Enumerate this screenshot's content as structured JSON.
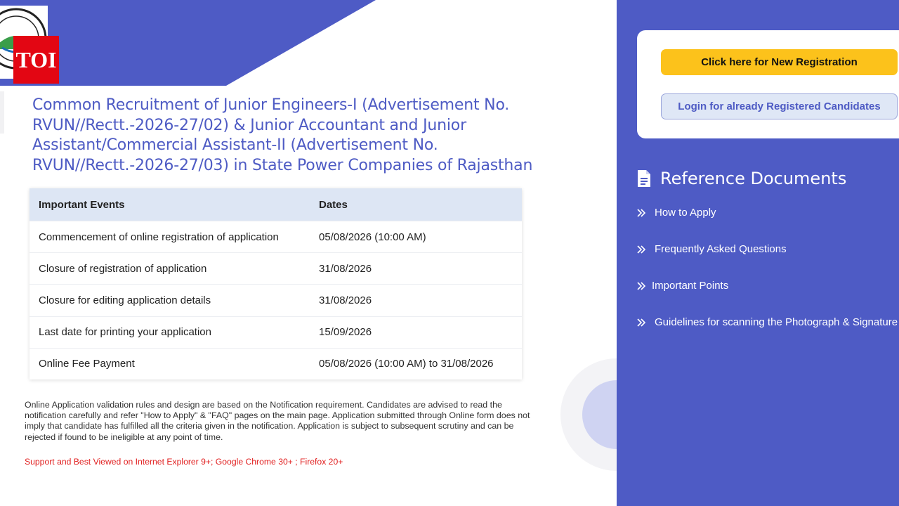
{
  "brand": {
    "badge_text": "TOI"
  },
  "title": "Common Recruitment of Junior Engineers-I (Advertisement No. RVUN//Rectt.-2026-27/02) & Junior Accountant and Junior Assistant/Commercial Assistant-II (Advertisement No. RVUN//Rectt.-2026-27/03) in State Power Companies of Rajasthan",
  "events_table": {
    "headers": [
      "Important Events",
      "Dates"
    ],
    "rows": [
      [
        "Commencement of online registration of application",
        "05/08/2026 (10:00 AM)"
      ],
      [
        "Closure of registration of application",
        "31/08/2026"
      ],
      [
        "Closure for editing application details",
        "31/08/2026"
      ],
      [
        "Last date for printing your application",
        "15/09/2026"
      ],
      [
        "Online Fee Payment",
        "05/08/2026 (10:00 AM) to 31/08/2026"
      ]
    ]
  },
  "note": "Online Application validation rules and design are based on the Notification requirement. Candidates are advised to read the notification carefully and refer \"How to Apply\" & \"FAQ\" pages on the main page. Application submitted through Online form does not imply that candidate has fulfilled all the criteria given in the notification. Application is subject to subsequent scrutiny and can be rejected if found to be ineligible at any point of time.",
  "support_text": "Support and Best Viewed on Internet Explorer 9+; Google Chrome 30+ ; Firefox 20+",
  "registration": {
    "new_label": "Click here for New Registration",
    "login_label": "Login for already Registered Candidates"
  },
  "reference": {
    "heading": "Reference Documents",
    "icon": "document-icon",
    "items": [
      {
        "label": "How to Apply",
        "icon": "double-chevron-right-icon"
      },
      {
        "label": "Frequently Asked Questions",
        "icon": "double-chevron-right-icon"
      },
      {
        "label": "Important Points",
        "icon": "double-chevron-right-icon"
      },
      {
        "label": "Guidelines for scanning the Photograph & Signature",
        "icon": "double-chevron-right-icon"
      }
    ]
  },
  "colors": {
    "primary": "#4e5bc5",
    "accent": "#fcc21b",
    "badge": "#e30613",
    "warning_text": "#e11f1f"
  }
}
